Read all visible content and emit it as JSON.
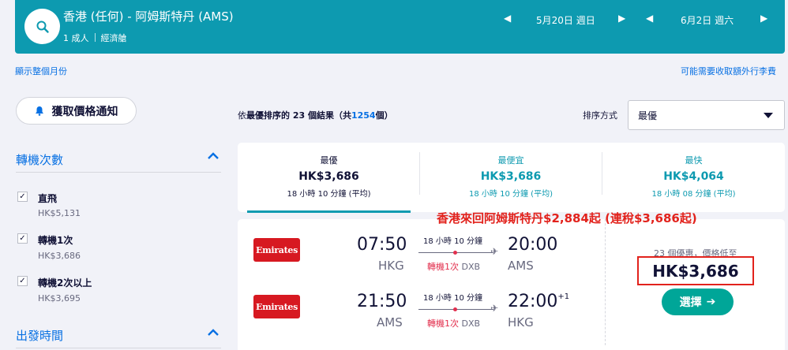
{
  "header": {
    "route": "香港 (任何) - 阿姆斯特丹 (AMS)",
    "passengers": "1 成人",
    "cabin": "經濟艙",
    "depart_date": "5月20日 週日",
    "return_date": "6月2日 週六"
  },
  "links": {
    "show_month": "顯示整個月份",
    "baggage": "可能需要收取額外行李費"
  },
  "price_alert": {
    "label": "獲取價格通知"
  },
  "filters": {
    "stops_title": "轉機次數",
    "stops": [
      {
        "label": "直飛",
        "price": "HK$5,131",
        "checked": true
      },
      {
        "label": "轉機1次",
        "price": "HK$3,686",
        "checked": true
      },
      {
        "label": "轉機2次以上",
        "price": "HK$3,695",
        "checked": true
      }
    ],
    "depart_title": "出發時間"
  },
  "results": {
    "prefix": "依",
    "sort_name": "最優",
    "mid": "排序的 23 個結果",
    "open": "（共",
    "total": "1254",
    "close": "個）",
    "sort_label": "排序方式",
    "sort_value": "最優"
  },
  "tabs": [
    {
      "label": "最優",
      "price": "HK$3,686",
      "duration": "18 小時 10 分鐘 (平均)",
      "active": true
    },
    {
      "label": "最便宜",
      "price": "HK$3,686",
      "duration": "18 小時 10 分鐘 (平均)",
      "active": false
    },
    {
      "label": "最快",
      "price": "HK$4,064",
      "duration": "18 小時 08 分鐘 (平均)",
      "active": false
    }
  ],
  "promo_text": "香港來回阿姆斯特丹$2,884起 (連稅$3,686起)",
  "flight": {
    "airline": "Emirates",
    "legs": [
      {
        "dep_time": "07:50",
        "dep_code": "HKG",
        "duration": "18 小時 10 分鐘",
        "stops": "轉機1次",
        "via": "DXB",
        "arr_time": "20:00",
        "arr_day": "",
        "arr_code": "AMS"
      },
      {
        "dep_time": "21:50",
        "dep_code": "AMS",
        "duration": "18 小時 10 分鐘",
        "stops": "轉機1次",
        "via": "DXB",
        "arr_time": "22:00",
        "arr_day": "+1",
        "arr_code": "HKG"
      }
    ],
    "deals_text": "23 個優惠，價格低至",
    "price": "HK$3,686",
    "select_label": "選擇"
  },
  "colors": {
    "teal": "#0d9ab0",
    "blue": "#0770e3",
    "green": "#00a698",
    "red": "#e2221c"
  }
}
